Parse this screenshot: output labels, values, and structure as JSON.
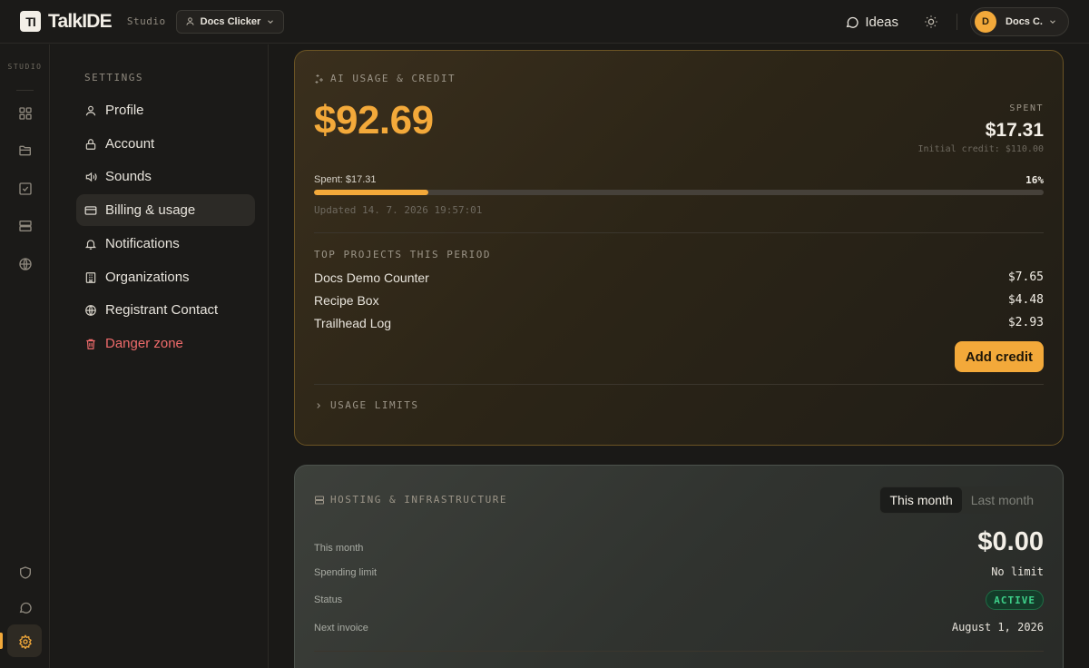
{
  "topbar": {
    "logo_mark": "TI",
    "app_name": "TalkIDE",
    "studio_tag": "Studio",
    "project_name": "Docs Clicker",
    "ideas_label": "Ideas",
    "user_initial": "D",
    "user_name": "Docs C."
  },
  "rail": {
    "label": "STUDIO",
    "icons": [
      "grid-icon",
      "folder-icon",
      "checkbox-icon",
      "server-icon",
      "globe-icon",
      "shield-icon",
      "chat-icon",
      "gear-icon"
    ],
    "active_icon": "gear-icon"
  },
  "settings": {
    "title": "SETTINGS",
    "items": [
      {
        "label": "Profile",
        "icon": "user-icon"
      },
      {
        "label": "Account",
        "icon": "lock-icon"
      },
      {
        "label": "Sounds",
        "icon": "speaker-icon"
      },
      {
        "label": "Billing & usage",
        "icon": "credit-card-icon",
        "active": true
      },
      {
        "label": "Notifications",
        "icon": "bell-icon"
      },
      {
        "label": "Organizations",
        "icon": "building-icon"
      },
      {
        "label": "Registrant Contact",
        "icon": "globe-icon"
      },
      {
        "label": "Danger zone",
        "icon": "trash-icon",
        "danger": true
      }
    ]
  },
  "ai_usage": {
    "header": "AI USAGE & CREDIT",
    "remaining": "$92.69",
    "spent_label": "SPENT",
    "spent_value": "$17.31",
    "initial_credit": "Initial credit: $110.00",
    "bar_label": "Spent: $17.31",
    "bar_percent_label": "16%",
    "spent_fraction": 0.157,
    "updated": "Updated 14. 7. 2026 19:57:01",
    "top_projects_header": "TOP PROJECTS THIS PERIOD",
    "top_projects": [
      {
        "name": "Docs Demo Counter",
        "amount": "$7.65"
      },
      {
        "name": "Recipe Box",
        "amount": "$4.48"
      },
      {
        "name": "Trailhead Log",
        "amount": "$2.93"
      }
    ],
    "add_credit_label": "Add credit",
    "usage_limits_label": "USAGE LIMITS"
  },
  "hosting": {
    "header": "HOSTING & INFRASTRUCTURE",
    "tabs": [
      "This month",
      "Last month"
    ],
    "active_tab": "This month",
    "this_month_label": "This month",
    "this_month_value": "$0.00",
    "spending_limit_label": "Spending limit",
    "spending_limit_value": "No limit",
    "status_label": "Status",
    "status_value": "ACTIVE",
    "next_invoice_label": "Next invoice",
    "next_invoice_value": "August 1, 2026"
  },
  "colors": {
    "accent": "#f3a93a",
    "danger": "#ef6b6b",
    "success": "#3ed08a",
    "background": "#1a1917"
  }
}
